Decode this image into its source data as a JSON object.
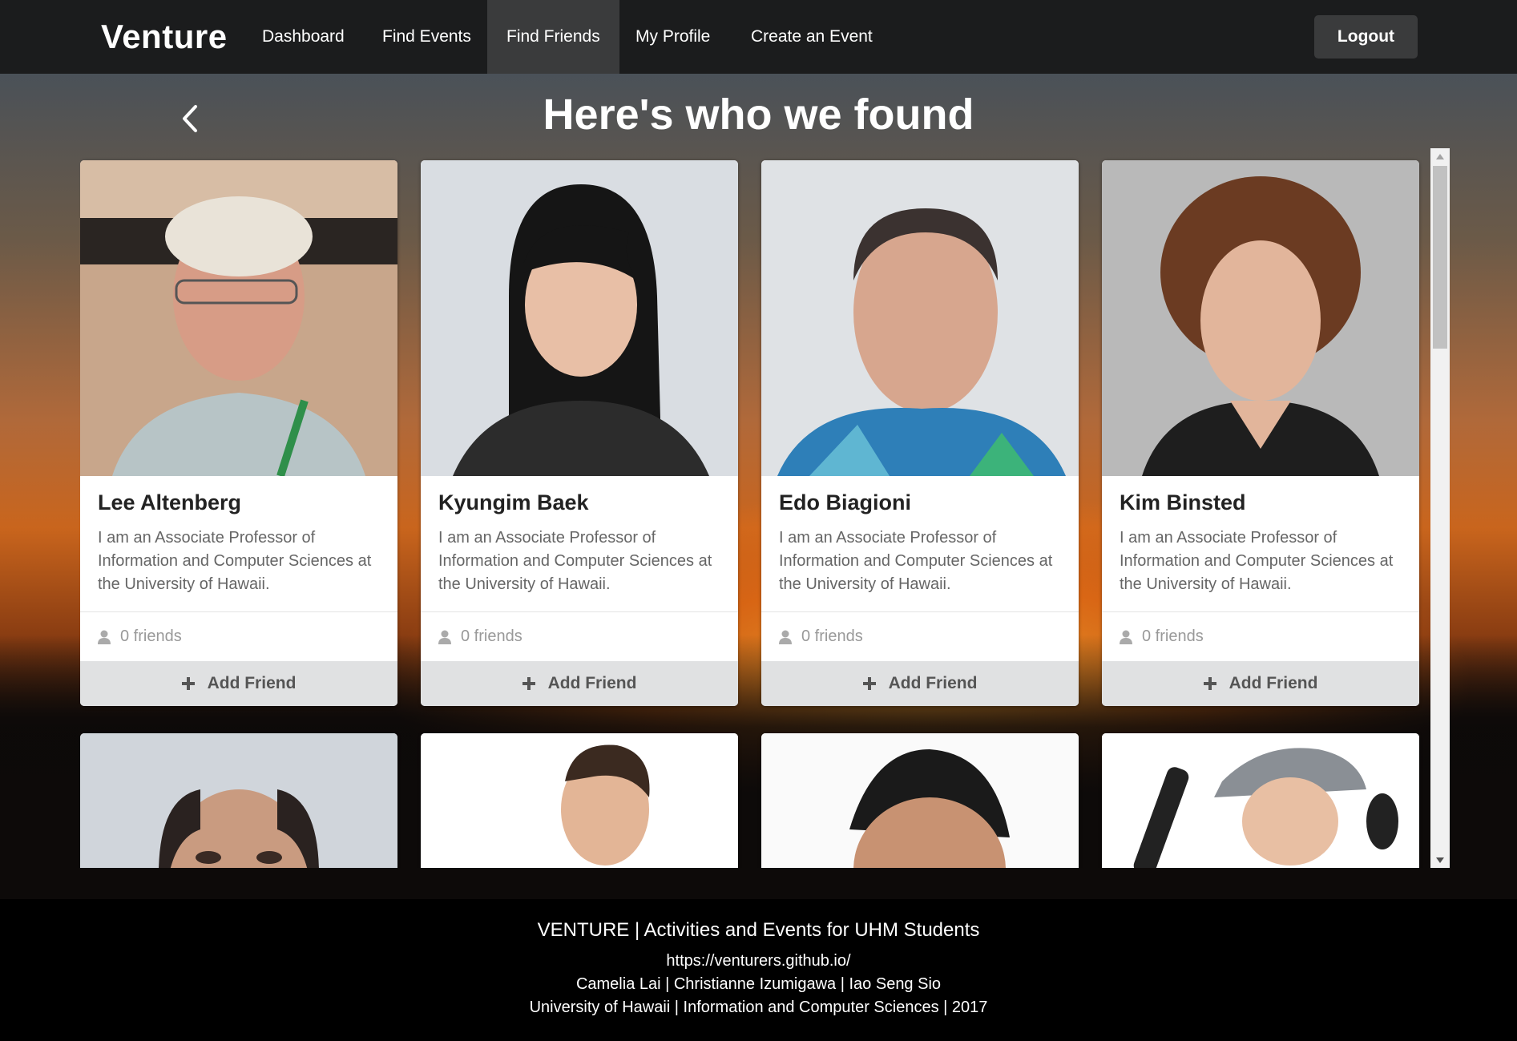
{
  "nav": {
    "brand": "Venture",
    "items": [
      {
        "label": "Dashboard",
        "active": false
      },
      {
        "label": "Find Events",
        "active": false
      },
      {
        "label": "Find Friends",
        "active": true
      },
      {
        "label": "My Profile",
        "active": false
      },
      {
        "label": "Create an Event",
        "active": false
      }
    ],
    "logout_label": "Logout"
  },
  "page": {
    "title": "Here's who we found",
    "back_icon": "chevron-left-icon"
  },
  "cards": [
    {
      "name": "Lee Altenberg",
      "description": "I am an Associate Professor of Information and Computer Sciences at the University of Hawaii.",
      "friends": "0 friends",
      "button": "Add Friend"
    },
    {
      "name": "Kyungim Baek",
      "description": "I am an Associate Professor of Information and Computer Sciences at the University of Hawaii.",
      "friends": "0 friends",
      "button": "Add Friend"
    },
    {
      "name": "Edo Biagioni",
      "description": "I am an Associate Professor of Information and Computer Sciences at the University of Hawaii.",
      "friends": "0 friends",
      "button": "Add Friend"
    },
    {
      "name": "Kim Binsted",
      "description": "I am an Associate Professor of Information and Computer Sciences at the University of Hawaii.",
      "friends": "0 friends",
      "button": "Add Friend"
    }
  ],
  "footer": {
    "title": "VENTURE | Activities and Events for UHM Students",
    "url": "https://venturers.github.io/",
    "authors": "Camelia Lai | Christianne Izumigawa | Iao Seng Sio",
    "credits": "University of Hawaii | Information and Computer Sciences | 2017"
  },
  "colors": {
    "navbar": "#1b1c1d",
    "active_nav": "#3a3b3c",
    "button_bg": "#e0e1e2",
    "footer": "#000000"
  }
}
